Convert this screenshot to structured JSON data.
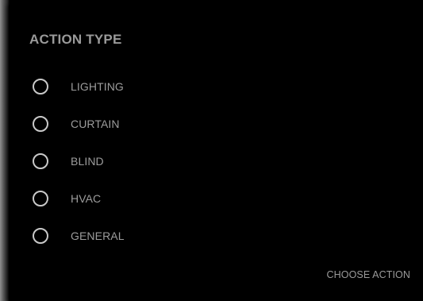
{
  "dialog": {
    "title": "ACTION TYPE",
    "options": [
      {
        "label": "LIGHTING",
        "selected": false
      },
      {
        "label": "CURTAIN",
        "selected": false
      },
      {
        "label": "BLIND",
        "selected": false
      },
      {
        "label": "HVAC",
        "selected": false
      },
      {
        "label": "GENERAL",
        "selected": false
      }
    ],
    "confirm_label": "CHOOSE ACTION"
  },
  "colors": {
    "dialog_background": "#000000",
    "text": "#9a9a9a",
    "radio_outline": "#c9c9c9"
  }
}
